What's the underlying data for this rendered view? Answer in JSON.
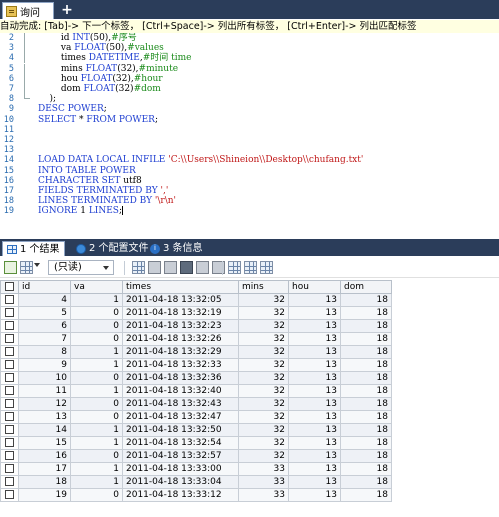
{
  "editor_tab": {
    "label": "询问",
    "add_label": "+"
  },
  "hint_text": "自动完成:  [Tab]-> 下一个标签， [Ctrl+Space]-> 列出所有标签， [Ctrl+Enter]-> 列出匹配标签",
  "code_lines": [
    {
      "n": "2",
      "tokens": [
        [
          "tx",
          "        id "
        ],
        [
          "ty",
          "INT"
        ],
        [
          "tx",
          "(50),"
        ],
        [
          "cm",
          "#序号"
        ]
      ]
    },
    {
      "n": "3",
      "tokens": [
        [
          "tx",
          "        va "
        ],
        [
          "ty",
          "FLOAT"
        ],
        [
          "tx",
          "(50),"
        ],
        [
          "cm",
          "#values"
        ]
      ]
    },
    {
      "n": "4",
      "tokens": [
        [
          "tx",
          "        times "
        ],
        [
          "ty",
          "DATETIME"
        ],
        [
          "tx",
          ","
        ],
        [
          "cm",
          "#时间 time"
        ]
      ]
    },
    {
      "n": "5",
      "tokens": [
        [
          "tx",
          "        mins "
        ],
        [
          "ty",
          "FLOAT"
        ],
        [
          "tx",
          "(32),"
        ],
        [
          "cm",
          "#minute"
        ]
      ]
    },
    {
      "n": "6",
      "tokens": [
        [
          "tx",
          "        hou "
        ],
        [
          "ty",
          "FLOAT"
        ],
        [
          "tx",
          "(32),"
        ],
        [
          "cm",
          "#hour"
        ]
      ]
    },
    {
      "n": "7",
      "tokens": [
        [
          "tx",
          "        dom "
        ],
        [
          "ty",
          "FLOAT"
        ],
        [
          "tx",
          "(32)"
        ],
        [
          "cm",
          "#dom"
        ]
      ]
    },
    {
      "n": "8",
      "tokens": [
        [
          "tx",
          "    );"
        ]
      ]
    },
    {
      "n": "9",
      "tokens": [
        [
          "kw",
          "DESC "
        ],
        [
          "kw",
          "POWER"
        ],
        [
          "tx",
          ";"
        ]
      ]
    },
    {
      "n": "10",
      "tokens": [
        [
          "kw",
          "SELECT "
        ],
        [
          "tx",
          "* "
        ],
        [
          "kw",
          "FROM "
        ],
        [
          "kw",
          "POWER"
        ],
        [
          "tx",
          ";"
        ]
      ]
    },
    {
      "n": "11",
      "tokens": []
    },
    {
      "n": "12",
      "tokens": []
    },
    {
      "n": "13",
      "tokens": []
    },
    {
      "n": "14",
      "tokens": [
        [
          "kw",
          "LOAD DATA LOCAL INFILE "
        ],
        [
          "st",
          "'C:\\\\Users\\\\Shineion\\\\Desktop\\\\chufang.txt'"
        ]
      ]
    },
    {
      "n": "15",
      "tokens": [
        [
          "kw",
          "INTO TABLE "
        ],
        [
          "kw",
          "POWER"
        ]
      ]
    },
    {
      "n": "16",
      "tokens": [
        [
          "kw",
          "CHARACTER SET "
        ],
        [
          "tx",
          "utf8"
        ]
      ]
    },
    {
      "n": "17",
      "tokens": [
        [
          "kw",
          "FIELDS TERMINATED BY "
        ],
        [
          "st",
          "','"
        ]
      ]
    },
    {
      "n": "18",
      "tokens": [
        [
          "kw",
          "LINES TERMINATED BY "
        ],
        [
          "st",
          "'\\r\\n'"
        ]
      ]
    },
    {
      "n": "19",
      "tokens": [
        [
          "kw",
          "IGNORE "
        ],
        [
          "tx",
          "1 "
        ],
        [
          "kw",
          "LINES"
        ],
        [
          "tx",
          ";"
        ]
      ]
    }
  ],
  "result_tabs": [
    {
      "label": "1 个结果",
      "active": true,
      "icon": "grid-icon"
    },
    {
      "label": "2 个配置文件",
      "active": false,
      "icon": "profile-icon"
    },
    {
      "label": "3 条信息",
      "active": false,
      "icon": "info-icon"
    }
  ],
  "toolbar": {
    "readonly_label": "(只读)"
  },
  "table": {
    "columns": [
      "id",
      "va",
      "times",
      "mins",
      "hou",
      "dom"
    ],
    "rows": [
      [
        "4",
        "1",
        "2011-04-18 13:32:05",
        "32",
        "13",
        "18"
      ],
      [
        "5",
        "0",
        "2011-04-18 13:32:19",
        "32",
        "13",
        "18"
      ],
      [
        "6",
        "0",
        "2011-04-18 13:32:23",
        "32",
        "13",
        "18"
      ],
      [
        "7",
        "0",
        "2011-04-18 13:32:26",
        "32",
        "13",
        "18"
      ],
      [
        "8",
        "1",
        "2011-04-18 13:32:29",
        "32",
        "13",
        "18"
      ],
      [
        "9",
        "1",
        "2011-04-18 13:32:33",
        "32",
        "13",
        "18"
      ],
      [
        "10",
        "0",
        "2011-04-18 13:32:36",
        "32",
        "13",
        "18"
      ],
      [
        "11",
        "1",
        "2011-04-18 13:32:40",
        "32",
        "13",
        "18"
      ],
      [
        "12",
        "0",
        "2011-04-18 13:32:43",
        "32",
        "13",
        "18"
      ],
      [
        "13",
        "0",
        "2011-04-18 13:32:47",
        "32",
        "13",
        "18"
      ],
      [
        "14",
        "1",
        "2011-04-18 13:32:50",
        "32",
        "13",
        "18"
      ],
      [
        "15",
        "1",
        "2011-04-18 13:32:54",
        "32",
        "13",
        "18"
      ],
      [
        "16",
        "0",
        "2011-04-18 13:32:57",
        "32",
        "13",
        "18"
      ],
      [
        "17",
        "1",
        "2011-04-18 13:33:00",
        "33",
        "13",
        "18"
      ],
      [
        "18",
        "1",
        "2011-04-18 13:33:04",
        "33",
        "13",
        "18"
      ],
      [
        "19",
        "0",
        "2011-04-18 13:33:12",
        "33",
        "13",
        "18"
      ]
    ]
  }
}
